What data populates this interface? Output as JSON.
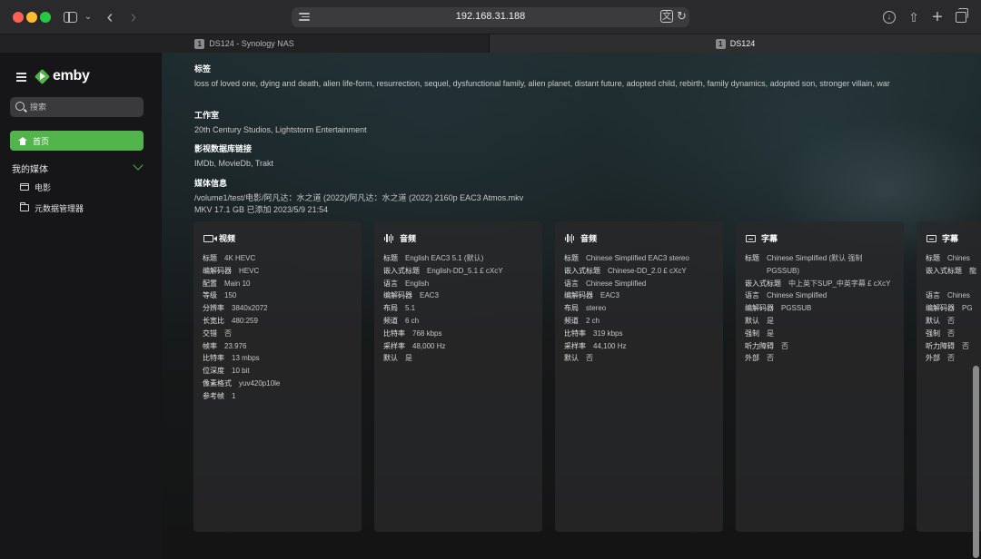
{
  "browser": {
    "url": "192.168.31.188",
    "tabs": [
      {
        "badge": "1",
        "title": "DS124 - Synology NAS"
      },
      {
        "badge": "1",
        "title": "DS124"
      }
    ]
  },
  "sidebar": {
    "logo_text": "emby",
    "search_placeholder": "搜索",
    "home_label": "首页",
    "section_label": "我的媒体",
    "items": [
      {
        "label": "电影",
        "icon": "film-icon"
      },
      {
        "label": "元数据管理器",
        "icon": "folder-icon"
      }
    ],
    "accent": "#52b54b"
  },
  "meta": {
    "tags_label": "标签",
    "tags_value": "loss of loved one, dying and death, alien life-form, resurrection, sequel, dysfunctional family, alien planet, distant future, adopted child, rebirth, family dynamics, adopted son, stronger villain, war",
    "studio_label": "工作室",
    "studio_value": "20th Century Studios, Lightstorm Entertainment",
    "links_label": "影视数据库链接",
    "links_value": "IMDb, MovieDb, Trakt",
    "media_label": "媒体信息",
    "media_path": "/volume1/test/电影/阿凡达：水之道 (2022)/阿凡达：水之道 (2022) 2160p EAC3 Atmos.mkv",
    "media_details": "MKV   17.1 GB   已添加 2023/5/9 21:54"
  },
  "streams": [
    {
      "title": "视频",
      "icon": "video-icon",
      "rows": [
        {
          "k": "标题",
          "v": "4K HEVC"
        },
        {
          "k": "编解码器",
          "v": "HEVC"
        },
        {
          "k": "配置",
          "v": "Main 10"
        },
        {
          "k": "等级",
          "v": "150"
        },
        {
          "k": "分辨率",
          "v": "3840x2072"
        },
        {
          "k": "长宽比",
          "v": "480:259"
        },
        {
          "k": "交错",
          "v": "否"
        },
        {
          "k": "帧率",
          "v": "23.976"
        },
        {
          "k": "比特率",
          "v": "13 mbps"
        },
        {
          "k": "位深度",
          "v": "10 bit"
        },
        {
          "k": "像素格式",
          "v": "yuv420p10le"
        },
        {
          "k": "参考帧",
          "v": "1"
        }
      ]
    },
    {
      "title": "音频",
      "icon": "audio-icon",
      "rows": [
        {
          "k": "标题",
          "v": "English EAC3 5.1 (默认)"
        },
        {
          "k": "嵌入式标题",
          "v": "English-DD_5.1 £ cXcY"
        },
        {
          "k": "语言",
          "v": "English"
        },
        {
          "k": "编解码器",
          "v": "EAC3"
        },
        {
          "k": "布局",
          "v": "5.1"
        },
        {
          "k": "频道",
          "v": "6 ch"
        },
        {
          "k": "比特率",
          "v": "768 kbps"
        },
        {
          "k": "采样率",
          "v": "48,000 Hz"
        },
        {
          "k": "默认",
          "v": "是"
        }
      ]
    },
    {
      "title": "音频",
      "icon": "audio-icon",
      "rows": [
        {
          "k": "标题",
          "v": "Chinese Simplified EAC3 stereo"
        },
        {
          "k": "嵌入式标题",
          "v": "Chinese-DD_2.0 £ cXcY"
        },
        {
          "k": "语言",
          "v": "Chinese Simplified"
        },
        {
          "k": "编解码器",
          "v": "EAC3"
        },
        {
          "k": "布局",
          "v": "stereo"
        },
        {
          "k": "频道",
          "v": "2 ch"
        },
        {
          "k": "比特率",
          "v": "319 kbps"
        },
        {
          "k": "采样率",
          "v": "44,100 Hz"
        },
        {
          "k": "默认",
          "v": "否"
        }
      ]
    },
    {
      "title": "字幕",
      "icon": "subtitle-icon",
      "rows": [
        {
          "k": "标题",
          "v": "Chinese Simplified (默认 强制 PGSSUB)"
        },
        {
          "k": "嵌入式标题",
          "v": "中上英下SUP_中英字幕 £ cXcY"
        },
        {
          "k": "语言",
          "v": "Chinese Simplified"
        },
        {
          "k": "编解码器",
          "v": "PGSSUB"
        },
        {
          "k": "默认",
          "v": "是"
        },
        {
          "k": "强制",
          "v": "是"
        },
        {
          "k": "听力障碍",
          "v": "否"
        },
        {
          "k": "外部",
          "v": "否"
        }
      ]
    },
    {
      "title": "字幕",
      "icon": "subtitle-icon",
      "rows": [
        {
          "k": "标题",
          "v": "Chines"
        },
        {
          "k": "嵌入式标题",
          "v": "龍"
        },
        {
          "k": "",
          "v": ""
        },
        {
          "k": "语言",
          "v": "Chines"
        },
        {
          "k": "编解码器",
          "v": "PG"
        },
        {
          "k": "默认",
          "v": "否"
        },
        {
          "k": "强制",
          "v": "否"
        },
        {
          "k": "听力障碍",
          "v": "否"
        },
        {
          "k": "外部",
          "v": "否"
        }
      ]
    }
  ]
}
